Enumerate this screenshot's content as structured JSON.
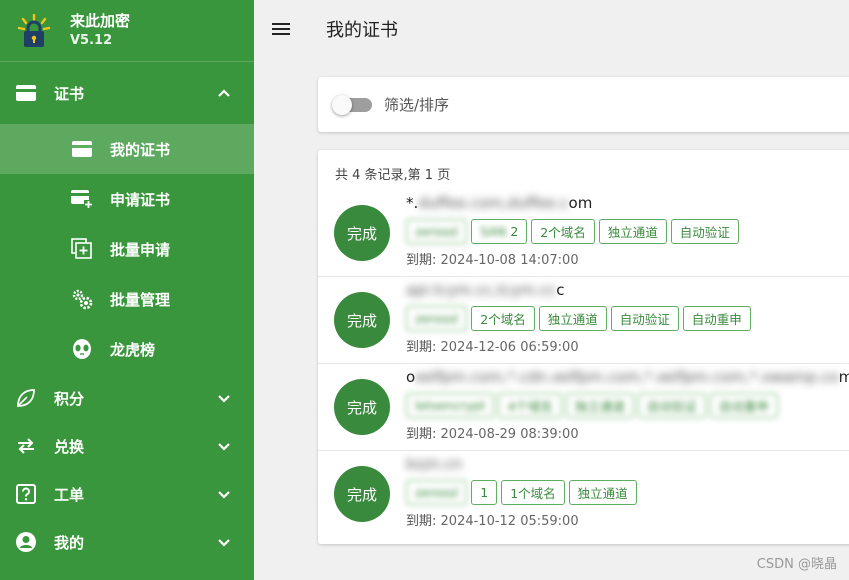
{
  "brand": {
    "name": "来此加密",
    "version": "V5.12"
  },
  "nav": {
    "cert": {
      "label": "证书",
      "icon": "card-icon"
    },
    "cert_sub": [
      {
        "label": "我的证书",
        "icon": "card-icon",
        "active": true
      },
      {
        "label": "申请证书",
        "icon": "card-add-icon"
      },
      {
        "label": "批量申请",
        "icon": "batch-add-icon"
      },
      {
        "label": "批量管理",
        "icon": "gears-icon"
      },
      {
        "label": "龙虎榜",
        "icon": "alien-icon"
      }
    ],
    "points": {
      "label": "积分",
      "icon": "leaf-icon"
    },
    "exchange": {
      "label": "兑换",
      "icon": "swap-icon"
    },
    "ticket": {
      "label": "工单",
      "icon": "question-icon"
    },
    "mine": {
      "label": "我的",
      "icon": "account-icon"
    }
  },
  "header": {
    "title": "我的证书"
  },
  "filter": {
    "label": "筛选/排序"
  },
  "list": {
    "summary": "共 4 条记录,第 1 页",
    "certs": [
      {
        "status": "完成",
        "domain_prefix": "*.",
        "domain_blurred": "duffee.com,duffee.c",
        "domain_suffix": "om",
        "chips_blurred": [
          "zerossl",
          "SAN"
        ],
        "chip_count": "2",
        "chips": [
          "2个域名",
          "独立通道",
          "自动验证"
        ],
        "expire_label": "到期:",
        "expire": "2024-10-08 14:07:00"
      },
      {
        "status": "完成",
        "domain_prefix": "",
        "domain_blurred": "api.tcym.cc,tcym.cc",
        "domain_suffix": "c",
        "chips_blurred": [
          "zerossl"
        ],
        "chip_count": "",
        "chips": [
          "2个域名",
          "独立通道",
          "自动验证",
          "自动重申"
        ],
        "expire_label": "到期:",
        "expire": "2024-12-06 06:59:00"
      },
      {
        "status": "完成",
        "domain_prefix": "o",
        "domain_blurred": "xelfpm.com,*.cdn.xelfpm.com,*.xelfpm.com,*.xwamp.co",
        "domain_suffix": "m",
        "chips_blurred": [
          "letsencrypt",
          "4个域名",
          "独立通道",
          "自动验证",
          "自动重申"
        ],
        "chip_count": "",
        "chips": [],
        "expire_label": "到期:",
        "expire": "2024-08-29 08:39:00"
      },
      {
        "status": "完成",
        "domain_prefix": "",
        "domain_blurred": "kszn.cn",
        "domain_suffix": "",
        "chips_blurred": [
          "zerossl"
        ],
        "chip_count": "1",
        "chips": [
          "1个域名",
          "独立通道"
        ],
        "expire_label": "到期:",
        "expire": "2024-10-12 05:59:00"
      }
    ]
  },
  "watermark": "CSDN @晓晶"
}
